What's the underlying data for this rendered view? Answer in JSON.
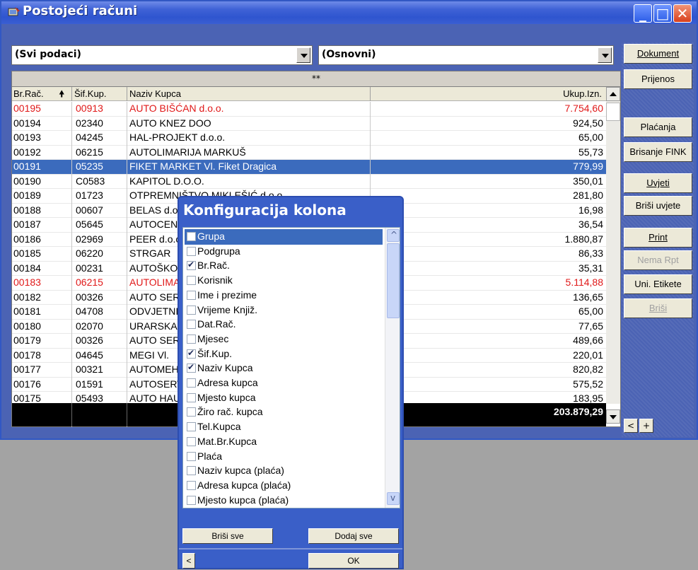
{
  "window": {
    "title": "Postojeći računi"
  },
  "filters": {
    "primary": "(Svi podaci)",
    "secondary": "(Osnovni)"
  },
  "grid": {
    "group_header": "**",
    "columns": [
      "Br.Rač.",
      "Šif.Kup.",
      "Naziv Kupca",
      "Ukup.Izn."
    ],
    "rows": [
      [
        "00195",
        "00913",
        "AUTO BIŠĆAN d.o.o.",
        "7.754,60"
      ],
      [
        "00194",
        "02340",
        "AUTO KNEZ DOO",
        "924,50"
      ],
      [
        "00193",
        "04245",
        "HAL-PROJEKT d.o.o.",
        "65,00"
      ],
      [
        "00192",
        "06215",
        "AUTOLIMARIJA MARKUŠ",
        "55,73"
      ],
      [
        "00191",
        "05235",
        "FIKET MARKET Vl. Fiket Dragica",
        "779,99"
      ],
      [
        "00190",
        "C0583",
        "KAPITOL D.O.O.",
        "350,01"
      ],
      [
        "00189",
        "01723",
        "OTPREMNIŠTVO MIKLEŠIĆ d.o.o.",
        "281,80"
      ],
      [
        "00188",
        "00607",
        "BELAS d.o.o.",
        "16,98"
      ],
      [
        "00187",
        "05645",
        "AUTOCENTAR",
        "36,54"
      ],
      [
        "00186",
        "02969",
        "PEER d.o.o.",
        "1.880,87"
      ],
      [
        "00185",
        "06220",
        "STRGAR",
        "86,33"
      ],
      [
        "00184",
        "00231",
        "AUTOŠKOLA",
        "35,31"
      ],
      [
        "00183",
        "06215",
        "AUTOLIMARIJA MARKUŠ",
        "5.114,88"
      ],
      [
        "00182",
        "00326",
        "AUTO SERVIS",
        "136,65"
      ],
      [
        "00181",
        "04708",
        "ODVJETNIČKI URED",
        "65,00"
      ],
      [
        "00180",
        "02070",
        "URARSKA RADIONICA",
        "77,65"
      ],
      [
        "00179",
        "00326",
        "AUTO SERVIS",
        "489,66"
      ],
      [
        "00178",
        "04645",
        "MEGI Vl.",
        "220,01"
      ],
      [
        "00177",
        "00321",
        "AUTOMEHANIKA",
        "820,82"
      ],
      [
        "00176",
        "01591",
        "AUTOSERVIS",
        "575,52"
      ],
      [
        "00175",
        "05493",
        "AUTO HAUS",
        "183,95"
      ]
    ],
    "red_rows": [
      0,
      12
    ],
    "selected_row": 4,
    "total": "203.879,29"
  },
  "side_buttons": [
    {
      "label": "Dokument",
      "enabled": true
    },
    {
      "label": "Prijenos",
      "enabled": true
    },
    {
      "label": "Plaćanja",
      "enabled": true
    },
    {
      "label": "Brisanje FINK",
      "enabled": true
    },
    {
      "label": "Uvjeti",
      "enabled": true
    },
    {
      "label": "Briši uvjete",
      "enabled": true
    },
    {
      "label": "Print",
      "enabled": true
    },
    {
      "label": "Nema Rpt",
      "enabled": false
    },
    {
      "label": "Uni. Etikete",
      "enabled": true
    },
    {
      "label": "Briši",
      "enabled": false
    }
  ],
  "nav": {
    "prev": "<",
    "add": "+"
  },
  "dialog": {
    "title": "Konfiguracija kolona",
    "items": [
      {
        "label": "Grupa",
        "checked": false
      },
      {
        "label": "Podgrupa",
        "checked": false
      },
      {
        "label": "Br.Rač.",
        "checked": true
      },
      {
        "label": "Korisnik",
        "checked": false
      },
      {
        "label": "Ime i prezime",
        "checked": false
      },
      {
        "label": "Vrijeme Knjiž.",
        "checked": false
      },
      {
        "label": "Dat.Rač.",
        "checked": false
      },
      {
        "label": "Mjesec",
        "checked": false
      },
      {
        "label": "Šif.Kup.",
        "checked": true
      },
      {
        "label": "Naziv Kupca",
        "checked": true
      },
      {
        "label": "Adresa kupca",
        "checked": false
      },
      {
        "label": "Mjesto kupca",
        "checked": false
      },
      {
        "label": "Žiro rač. kupca",
        "checked": false
      },
      {
        "label": "Tel.Kupca",
        "checked": false
      },
      {
        "label": "Mat.Br.Kupca",
        "checked": false
      },
      {
        "label": "Plaća",
        "checked": false
      },
      {
        "label": "Naziv kupca (plaća)",
        "checked": false
      },
      {
        "label": "Adresa kupca (plaća)",
        "checked": false
      },
      {
        "label": "Mjesto kupca (plaća)",
        "checked": false
      }
    ],
    "highlighted_item": 0,
    "clear_all": "Briši sve",
    "add_all": "Dodaj sve",
    "back": "<",
    "ok": "OK"
  }
}
